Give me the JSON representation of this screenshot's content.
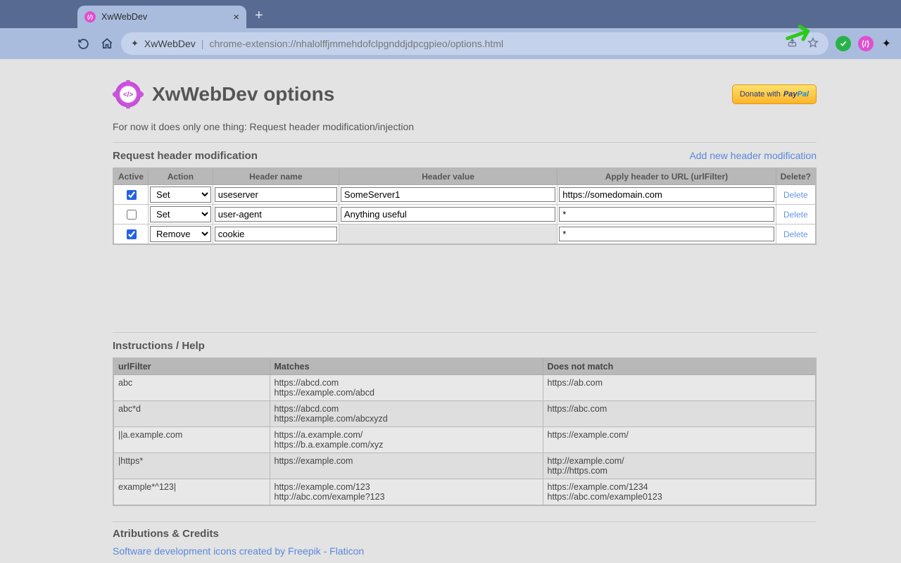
{
  "browser": {
    "tab_title": "XwWebDev",
    "addr_app": "XwWebDev",
    "addr_path": "chrome-extension://nhalolffjmmehdofclpgnddjdpcgpieo/options.html"
  },
  "header": {
    "title": "XwWebDev options",
    "donate_prefix": "Donate with",
    "donate_brand_a": "Pay",
    "donate_brand_b": "Pal"
  },
  "intro": "For now it does only one thing: Request header modification/injection",
  "rules_section": {
    "heading": "Request header modification",
    "add_link": "Add new header modification",
    "columns": {
      "active": "Active",
      "action": "Action",
      "name": "Header name",
      "value": "Header value",
      "url": "Apply header to URL (urlFilter)",
      "del": "Delete?"
    },
    "delete_label": "Delete",
    "rows": [
      {
        "active": true,
        "action": "Set",
        "name": "useserver",
        "value": "SomeServer1",
        "value_disabled": false,
        "url": "https://somedomain.com"
      },
      {
        "active": false,
        "action": "Set",
        "name": "user-agent",
        "value": "Anything useful",
        "value_disabled": false,
        "url": "*"
      },
      {
        "active": true,
        "action": "Remove",
        "name": "cookie",
        "value": "",
        "value_disabled": true,
        "url": "*"
      }
    ]
  },
  "help": {
    "heading": "Instructions / Help",
    "columns": {
      "filter": "urlFilter",
      "matches": "Matches",
      "nomatch": "Does not match"
    },
    "rows": [
      {
        "filter": "abc",
        "matches": "https://abcd.com\nhttps://example.com/abcd",
        "nomatch": "https://ab.com"
      },
      {
        "filter": "abc*d",
        "matches": "https://abcd.com\nhttps://example.com/abcxyzd",
        "nomatch": "https://abc.com"
      },
      {
        "filter": "||a.example.com",
        "matches": "https://a.example.com/\nhttps://b.a.example.com/xyz",
        "nomatch": "https://example.com/"
      },
      {
        "filter": "|https*",
        "matches": "https://example.com",
        "nomatch": "http://example.com/\nhttp://https.com"
      },
      {
        "filter": "example*^123|",
        "matches": "https://example.com/123\nhttp://abc.com/example?123",
        "nomatch": "https://example.com/1234\nhttps://abc.com/example0123"
      }
    ]
  },
  "attrib": {
    "heading": "Atributions & Credits",
    "link": "Software development icons created by Freepik - Flaticon"
  }
}
